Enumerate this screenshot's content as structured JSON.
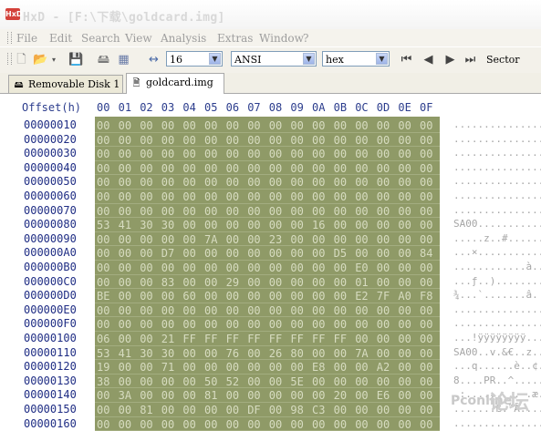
{
  "window": {
    "title": "HxD - [F:\\下载\\goldcard.img]",
    "app_icon_label": "HxD"
  },
  "menu": [
    "File",
    "Edit",
    "Search",
    "View",
    "Analysis",
    "Extras",
    "Window",
    "?"
  ],
  "toolbar": {
    "bytes_per_row": "16",
    "charset": "ANSI",
    "offset_base": "hex",
    "sector_label": "Sector"
  },
  "tabs": [
    {
      "label": "Removable Disk 1",
      "active": false
    },
    {
      "label": "goldcard.img",
      "active": true
    }
  ],
  "hex": {
    "offset_header": "Offset(h)",
    "columns": [
      "00",
      "01",
      "02",
      "03",
      "04",
      "05",
      "06",
      "07",
      "08",
      "09",
      "0A",
      "0B",
      "0C",
      "0D",
      "0E",
      "0F"
    ],
    "rows": [
      {
        "offset": "00000010",
        "bytes": [
          "00",
          "00",
          "00",
          "00",
          "00",
          "00",
          "00",
          "00",
          "00",
          "00",
          "00",
          "00",
          "00",
          "00",
          "00",
          "00"
        ],
        "ascii": "................"
      },
      {
        "offset": "00000020",
        "bytes": [
          "00",
          "00",
          "00",
          "00",
          "00",
          "00",
          "00",
          "00",
          "00",
          "00",
          "00",
          "00",
          "00",
          "00",
          "00",
          "00"
        ],
        "ascii": "................"
      },
      {
        "offset": "00000030",
        "bytes": [
          "00",
          "00",
          "00",
          "00",
          "00",
          "00",
          "00",
          "00",
          "00",
          "00",
          "00",
          "00",
          "00",
          "00",
          "00",
          "00"
        ],
        "ascii": "................"
      },
      {
        "offset": "00000040",
        "bytes": [
          "00",
          "00",
          "00",
          "00",
          "00",
          "00",
          "00",
          "00",
          "00",
          "00",
          "00",
          "00",
          "00",
          "00",
          "00",
          "00"
        ],
        "ascii": "................"
      },
      {
        "offset": "00000050",
        "bytes": [
          "00",
          "00",
          "00",
          "00",
          "00",
          "00",
          "00",
          "00",
          "00",
          "00",
          "00",
          "00",
          "00",
          "00",
          "00",
          "00"
        ],
        "ascii": "................"
      },
      {
        "offset": "00000060",
        "bytes": [
          "00",
          "00",
          "00",
          "00",
          "00",
          "00",
          "00",
          "00",
          "00",
          "00",
          "00",
          "00",
          "00",
          "00",
          "00",
          "00"
        ],
        "ascii": "................"
      },
      {
        "offset": "00000070",
        "bytes": [
          "00",
          "00",
          "00",
          "00",
          "00",
          "00",
          "00",
          "00",
          "00",
          "00",
          "00",
          "00",
          "00",
          "00",
          "00",
          "00"
        ],
        "ascii": "................"
      },
      {
        "offset": "00000080",
        "bytes": [
          "53",
          "41",
          "30",
          "30",
          "00",
          "00",
          "00",
          "00",
          "00",
          "00",
          "16",
          "00",
          "00",
          "00",
          "00",
          "00"
        ],
        "ascii": "SA00............"
      },
      {
        "offset": "00000090",
        "bytes": [
          "00",
          "00",
          "00",
          "00",
          "00",
          "7A",
          "00",
          "00",
          "23",
          "00",
          "00",
          "00",
          "00",
          "00",
          "00",
          "00"
        ],
        "ascii": ".....z..#......."
      },
      {
        "offset": "000000A0",
        "bytes": [
          "00",
          "00",
          "00",
          "D7",
          "00",
          "00",
          "00",
          "00",
          "00",
          "00",
          "00",
          "D5",
          "00",
          "00",
          "00",
          "84"
        ],
        "ascii": "...×...........„"
      },
      {
        "offset": "000000B0",
        "bytes": [
          "00",
          "00",
          "00",
          "00",
          "00",
          "00",
          "00",
          "00",
          "00",
          "00",
          "00",
          "00",
          "E0",
          "00",
          "00",
          "00"
        ],
        "ascii": "............à..."
      },
      {
        "offset": "000000C0",
        "bytes": [
          "00",
          "00",
          "00",
          "83",
          "00",
          "00",
          "29",
          "00",
          "00",
          "00",
          "00",
          "00",
          "01",
          "00",
          "00",
          "00"
        ],
        "ascii": "...ƒ..)........."
      },
      {
        "offset": "000000D0",
        "bytes": [
          "BE",
          "00",
          "00",
          "00",
          "60",
          "00",
          "00",
          "00",
          "00",
          "00",
          "00",
          "00",
          "E2",
          "7F",
          "A0",
          "F8"
        ],
        "ascii": "¾...`.......â. ø"
      },
      {
        "offset": "000000E0",
        "bytes": [
          "00",
          "00",
          "00",
          "00",
          "00",
          "00",
          "00",
          "00",
          "00",
          "00",
          "00",
          "00",
          "00",
          "00",
          "00",
          "00"
        ],
        "ascii": "................"
      },
      {
        "offset": "000000F0",
        "bytes": [
          "00",
          "00",
          "00",
          "00",
          "00",
          "00",
          "00",
          "00",
          "00",
          "00",
          "00",
          "00",
          "00",
          "00",
          "00",
          "00"
        ],
        "ascii": "................"
      },
      {
        "offset": "00000100",
        "bytes": [
          "06",
          "00",
          "00",
          "21",
          "FF",
          "FF",
          "FF",
          "FF",
          "FF",
          "FF",
          "FF",
          "FF",
          "00",
          "00",
          "00",
          "00"
        ],
        "ascii": "...!ÿÿÿÿÿÿÿÿ...."
      },
      {
        "offset": "00000110",
        "bytes": [
          "53",
          "41",
          "30",
          "30",
          "00",
          "00",
          "76",
          "00",
          "26",
          "80",
          "00",
          "00",
          "7A",
          "00",
          "00",
          "00"
        ],
        "ascii": "SA00..v.&€..z..."
      },
      {
        "offset": "00000120",
        "bytes": [
          "19",
          "00",
          "00",
          "71",
          "00",
          "00",
          "00",
          "00",
          "00",
          "00",
          "E8",
          "00",
          "00",
          "A2",
          "00",
          "00"
        ],
        "ascii": "...q......è..¢.."
      },
      {
        "offset": "00000130",
        "bytes": [
          "38",
          "00",
          "00",
          "00",
          "00",
          "50",
          "52",
          "00",
          "00",
          "5E",
          "00",
          "00",
          "00",
          "00",
          "00",
          "00"
        ],
        "ascii": "8....PR..^......"
      },
      {
        "offset": "00000140",
        "bytes": [
          "00",
          "3A",
          "00",
          "00",
          "00",
          "81",
          "00",
          "00",
          "00",
          "00",
          "00",
          "20",
          "00",
          "E6",
          "00",
          "00"
        ],
        "ascii": ".:......... .æ.."
      },
      {
        "offset": "00000150",
        "bytes": [
          "00",
          "00",
          "81",
          "00",
          "00",
          "00",
          "00",
          "DF",
          "00",
          "98",
          "C3",
          "00",
          "00",
          "00",
          "00",
          "00"
        ],
        "ascii": ".......ß.˜Ã....."
      },
      {
        "offset": "00000160",
        "bytes": [
          "00",
          "00",
          "00",
          "00",
          "00",
          "00",
          "00",
          "00",
          "00",
          "00",
          "00",
          "00",
          "00",
          "00",
          "00",
          "00"
        ],
        "ascii": "................"
      }
    ]
  },
  "watermark": {
    "left": "Pconline",
    "right": "论坛"
  },
  "colors": {
    "hex_bg": "#8f9a67",
    "offset_text": "#1f2d84",
    "title_icon": "#d4413a"
  }
}
